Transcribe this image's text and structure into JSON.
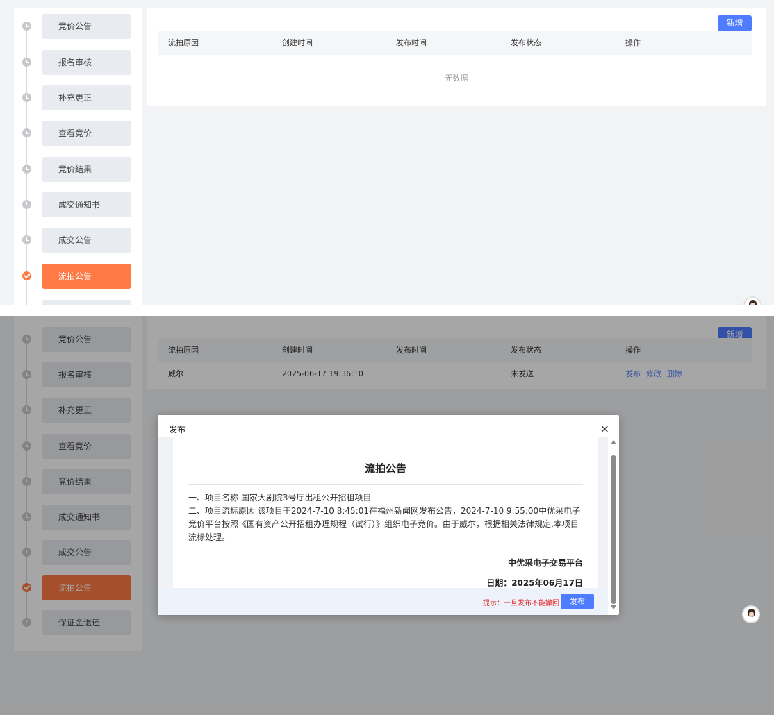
{
  "steps": [
    {
      "label": "竞价公告",
      "active": false
    },
    {
      "label": "报名审核",
      "active": false
    },
    {
      "label": "补充更正",
      "active": false
    },
    {
      "label": "查看竞价",
      "active": false
    },
    {
      "label": "竞价结果",
      "active": false
    },
    {
      "label": "成交通知书",
      "active": false
    },
    {
      "label": "成交公告",
      "active": false
    },
    {
      "label": "流拍公告",
      "active": true
    },
    {
      "label": "保证金退还",
      "active": false
    }
  ],
  "toolbar": {
    "add_label": "新增"
  },
  "table": {
    "columns": [
      "流拍原因",
      "创建时间",
      "发布时间",
      "发布状态",
      "操作"
    ],
    "empty_text": "无数据",
    "rows": [
      {
        "reason": "威尔",
        "created": "2025-06-17 19:36:10",
        "published": "",
        "status": "未发送",
        "actions": [
          "发布",
          "修改",
          "删除"
        ]
      }
    ]
  },
  "modal": {
    "title": "发布",
    "close": "×",
    "doc_title": "流拍公告",
    "line1": "一、项目名称 国家大剧院3号厅出租公开招租项目",
    "line2": "二、项目流标原因 该项目于2024-7-10 8:45:01在福州新闻网发布公告，2024-7-10 9:55:00中优采电子竞价平台按照《国有资产公开招租办理规程（试行）》组织电子竞价。由于威尔，根据相关法律规定,本项目流标处理。",
    "org": "中优采电子交易平台",
    "date": "日期：2025年06月17日",
    "tip": "提示：一旦发布不能撤回",
    "publish_label": "发布"
  },
  "colors": {
    "accent": "#4d7cfe",
    "active_step": "#ff7a45",
    "warning": "#e02020"
  }
}
